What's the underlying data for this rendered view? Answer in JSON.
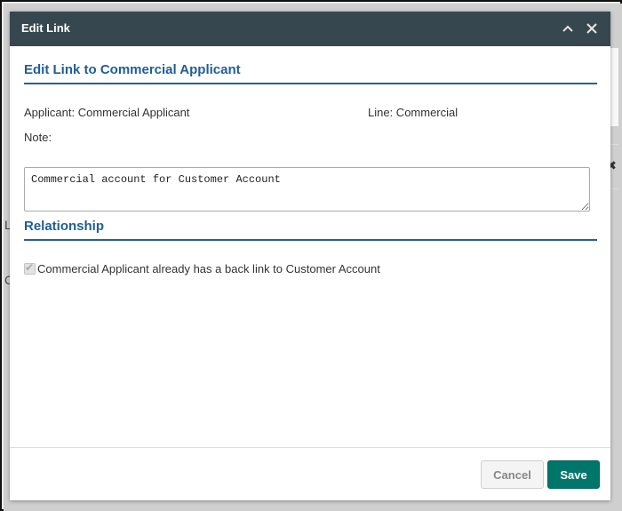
{
  "background": {
    "sidebar_letters": [
      "L",
      "C"
    ],
    "puzzle_icon": "puzzle-icon"
  },
  "modal": {
    "title": "Edit Link",
    "header_icons": [
      "chevron-up-icon",
      "close-icon"
    ],
    "section_edit": {
      "title": "Edit Link to Commercial Applicant"
    },
    "applicant_text": "Applicant: Commercial Applicant",
    "line_text": "Line: Commercial",
    "note_label": "Note:",
    "note_value": "Commercial account for Customer Account",
    "section_relationship": {
      "title": "Relationship"
    },
    "backlink_checkbox": {
      "checked": true,
      "disabled": true,
      "label": "Commercial Applicant already has a back link to Customer Account"
    },
    "buttons": {
      "cancel": "Cancel",
      "save": "Save"
    }
  },
  "colors": {
    "header_bg": "#37474f",
    "section_title": "#1f5e94",
    "save_button": "#00766a"
  }
}
